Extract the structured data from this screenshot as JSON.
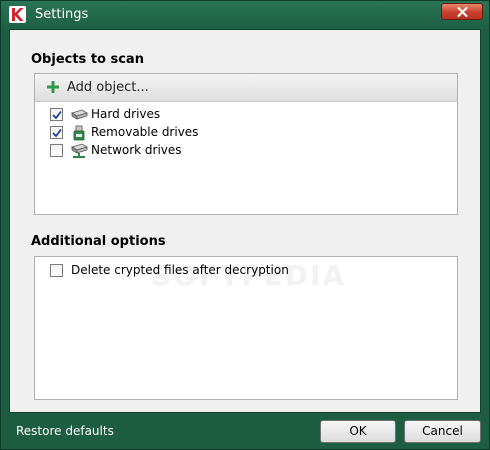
{
  "window": {
    "title": "Settings"
  },
  "objects_section": {
    "title": "Objects to scan",
    "add_label": "Add object...",
    "items": [
      {
        "label": "Hard drives",
        "checked": true,
        "icon": "hard-drive-icon"
      },
      {
        "label": "Removable drives",
        "checked": true,
        "icon": "usb-drive-icon"
      },
      {
        "label": "Network drives",
        "checked": false,
        "icon": "network-drive-icon"
      }
    ]
  },
  "options_section": {
    "title": "Additional options",
    "items": [
      {
        "label": "Delete crypted files after decryption",
        "checked": false
      }
    ]
  },
  "footer": {
    "restore_label": "Restore defaults",
    "ok_label": "OK",
    "cancel_label": "Cancel"
  },
  "watermark": "SOFTPEDIA",
  "colors": {
    "frame": "#1d5e43",
    "client": "#f0f0f0",
    "accent_plus": "#2e9a4c",
    "close": "#c9412b"
  }
}
